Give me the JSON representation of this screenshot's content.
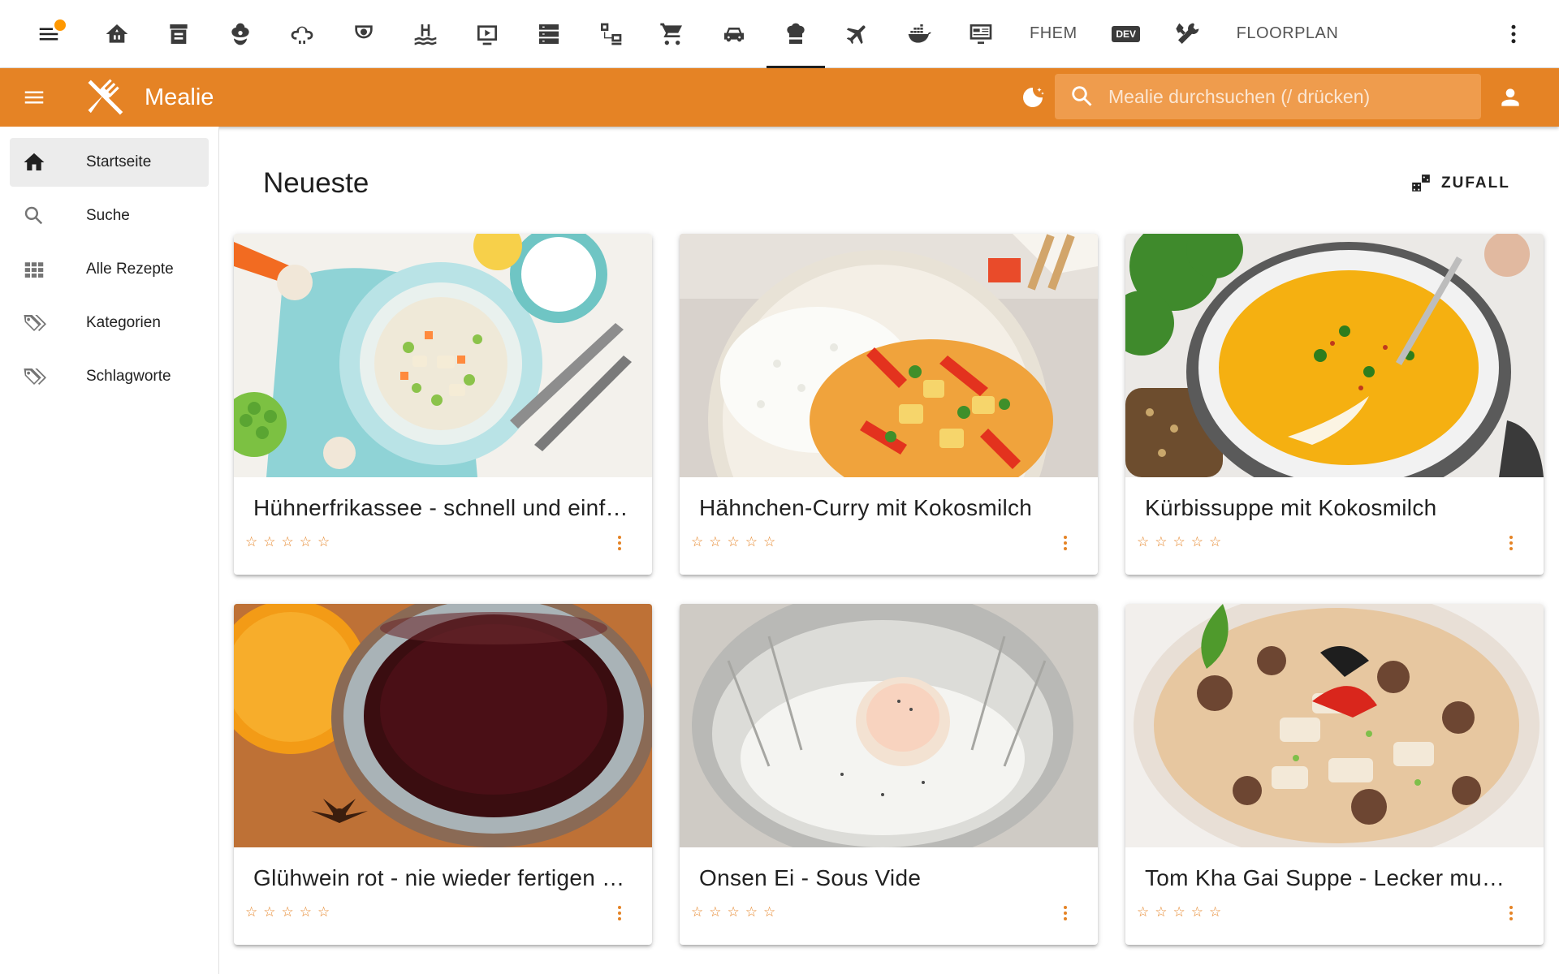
{
  "ha_bar": {
    "tabs": [
      {
        "icon": "home-automation-icon",
        "name": "ha-tab-home"
      },
      {
        "icon": "archive-icon",
        "name": "ha-tab-archive"
      },
      {
        "icon": "flower-icon",
        "name": "ha-tab-garden"
      },
      {
        "icon": "weather-icon",
        "name": "ha-tab-weather"
      },
      {
        "icon": "security-camera-icon",
        "name": "ha-tab-security"
      },
      {
        "icon": "pool-icon",
        "name": "ha-tab-pool"
      },
      {
        "icon": "media-player-icon",
        "name": "ha-tab-media"
      },
      {
        "icon": "server-icon",
        "name": "ha-tab-server"
      },
      {
        "icon": "network-icon",
        "name": "ha-tab-network"
      },
      {
        "icon": "cart-icon",
        "name": "ha-tab-shopping"
      },
      {
        "icon": "car-icon",
        "name": "ha-tab-car"
      },
      {
        "icon": "chef-hat-icon",
        "name": "ha-tab-mealie",
        "active": true
      },
      {
        "icon": "airplane-icon",
        "name": "ha-tab-travel"
      },
      {
        "icon": "docker-icon",
        "name": "ha-tab-docker"
      },
      {
        "icon": "monitor-dashboard-icon",
        "name": "ha-tab-monitor"
      }
    ],
    "fhem_label": "FHEM",
    "dev_label": "DEV",
    "floorplan_label": "FLOORPLAN"
  },
  "app_bar": {
    "title": "Mealie",
    "search_placeholder": "Mealie durchsuchen (/ drücken)",
    "accent": "#E58325"
  },
  "sidebar": {
    "items": [
      {
        "label": "Startseite",
        "icon": "home-icon",
        "active": true
      },
      {
        "label": "Suche",
        "icon": "search-icon"
      },
      {
        "label": "Alle Rezepte",
        "icon": "grid-icon"
      },
      {
        "label": "Kategorien",
        "icon": "tags-icon"
      },
      {
        "label": "Schlagworte",
        "icon": "tags-icon"
      }
    ]
  },
  "main": {
    "section_title": "Neueste",
    "random_label": "ZUFALL",
    "recipes": [
      {
        "title": "Hühnerfrikassee - schnell und einfach",
        "rating": 0
      },
      {
        "title": "Hähnchen-Curry mit Kokosmilch",
        "rating": 0
      },
      {
        "title": "Kürbissuppe mit Kokosmilch",
        "rating": 0
      },
      {
        "title": "Glühwein rot - nie wieder fertigen kaufen",
        "rating": 0
      },
      {
        "title": "Onsen Ei - Sous Vide",
        "rating": 0
      },
      {
        "title": "Tom Kha Gai Suppe - Lecker mu…",
        "rating": 0
      }
    ]
  }
}
